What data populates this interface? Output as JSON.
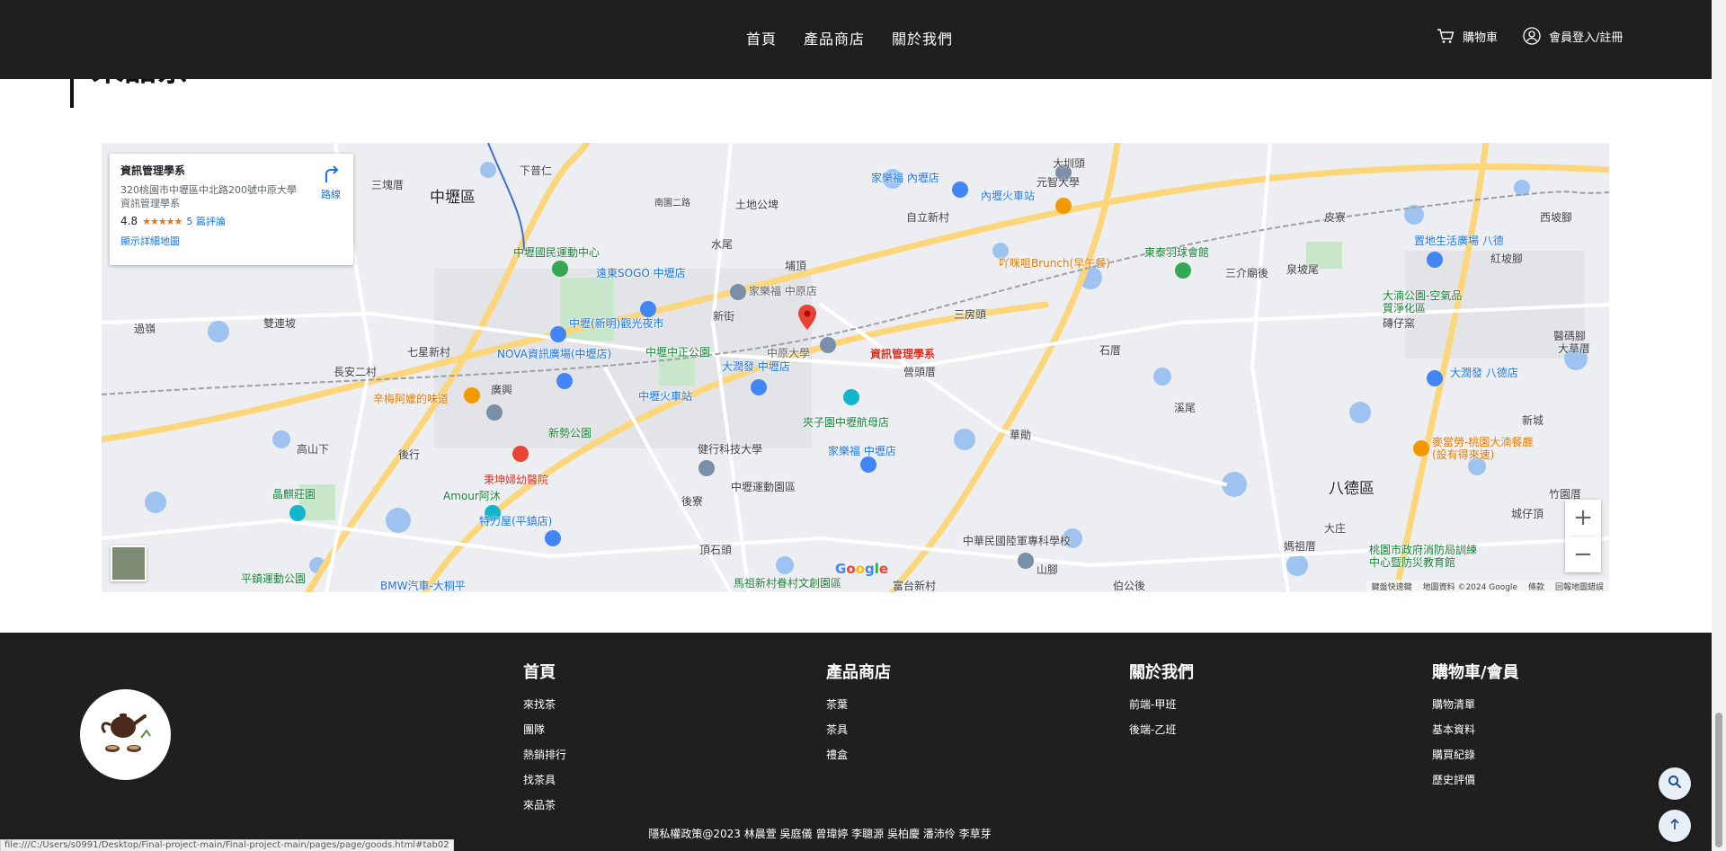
{
  "nav": {
    "links": [
      "首頁",
      "產品商店",
      "關於我們"
    ],
    "cart_label": "購物車",
    "member_label": "會員登入/註冊"
  },
  "section": {
    "title": "來品茶"
  },
  "map": {
    "info_card": {
      "title": "資訊管理學系",
      "address": "320桃園市中壢區中北路200號中原大學資訊管理學系",
      "rating": "4.8",
      "stars": "★★★★★",
      "reviews": "5 篇評論",
      "directions": "路線",
      "view_larger": "顯示詳細地圖"
    },
    "labels": {
      "zhongli": "中壢區",
      "bade": "八德區",
      "target": "資訊管理學系",
      "cycu": "中原大學",
      "neili_station": "內壢火車站",
      "zhongli_station": "中壢火車站",
      "carrefour_neili": "家樂福 內壢店",
      "carrefour_zhongyuan": "家樂福 中原店",
      "carrefour_zhongli": "家樂福 中壢店",
      "sogo": "遠東SOGO 中壢店",
      "night_market": "中壢(新明)觀光夜市",
      "nova": "NOVA資訊廣場(中壢店)",
      "zhongzheng_park": "中壢中正公園",
      "rt_mart": "大潤發 中壢店",
      "rt_mart_bade": "大潤發 八德店",
      "stadium": "中壢國民運動中心",
      "brunch": "吖咪咀Brunch(早午餐)",
      "badminton": "東泰羽球會館",
      "yuan_zhi": "元智大學",
      "aviation": "夾子園中壢航母店",
      "jianxing": "健行科技大學",
      "sports_park": "中壢運動園區",
      "hospital": "秉坤婦幼醫院",
      "amour": "Amour阿沐",
      "tiger": "特力屋(平鎮店)",
      "xinshi": "新勢公園",
      "taste": "辛梅阿嬤的味道",
      "jingqi": "晶麒莊園",
      "pingzhen": "平鎮運動公園",
      "bmw": "BMW汽車-大桐平",
      "nursing": "中華民國陸軍專科學校",
      "village": "馬祖新村眷村文創園區",
      "mcdonalds": "麥當勞-桃園大湳餐廳(設有得來速)",
      "bade_park": "大湳公園-空氣品質淨化區",
      "bade_life": "置地生活廣場 八德",
      "fire": "桃園市政府消防局訓練中心暨防災教育館",
      "places": [
        "三塊厝",
        "下普仁",
        "土地公埤",
        "南園二路",
        "水尾",
        "埔頂",
        "新街",
        "自立新村",
        "大圳頭",
        "三房頭",
        "三介廟後",
        "泉坡尾",
        "皮寮",
        "西坡腳",
        "紅坡腳",
        "過嶺",
        "雙連坡",
        "七星新村",
        "長安二村",
        "廣興",
        "後行",
        "高山下",
        "石厝",
        "溪尾",
        "營頭厝",
        "新城",
        "竹園厝",
        "城仔頂",
        "大庄",
        "媽祖厝",
        "伯公後",
        "山腳",
        "華勛",
        "後寮",
        "頂石頭",
        "富台新村",
        "大草厝",
        "醫碼腳",
        "磚仔窯",
        "中壢",
        "山腳"
      ],
      "google": "Google"
    },
    "footer": [
      "鍵盤快速鍵",
      "地圖資料 ©2024 Google",
      "條款",
      "回報地圖錯誤"
    ],
    "zoom_in": "+",
    "zoom_out": "−"
  },
  "footer": {
    "columns": [
      {
        "title": "首頁",
        "links": [
          "來找茶",
          "團隊",
          "熱銷排行",
          "找茶具",
          "來品茶"
        ]
      },
      {
        "title": "產品商店",
        "links": [
          "茶葉",
          "茶具",
          "禮盒"
        ]
      },
      {
        "title": "關於我們",
        "links": [
          "前端-甲班",
          "後端-乙班"
        ]
      },
      {
        "title": "購物車/會員",
        "links": [
          "購物清單",
          "基本資料",
          "購買紀錄",
          "歷史評價"
        ]
      }
    ],
    "copyright": "隱私權政策@2023 林晨萱 吳庭儀 曾瑋婷 李聰源 吳柏慶 潘沛伶 李草芽"
  },
  "statusbar": {
    "url": "file:///C:/Users/s0991/Desktop/Final-project-main/Final-project-main/pages/page/goods.html#tab02"
  },
  "colors": {
    "nav_bg": "#1f1f1f",
    "footer_bg": "#1f1f1f",
    "map_bg": "#eceef2",
    "marker": "#ea4335"
  }
}
